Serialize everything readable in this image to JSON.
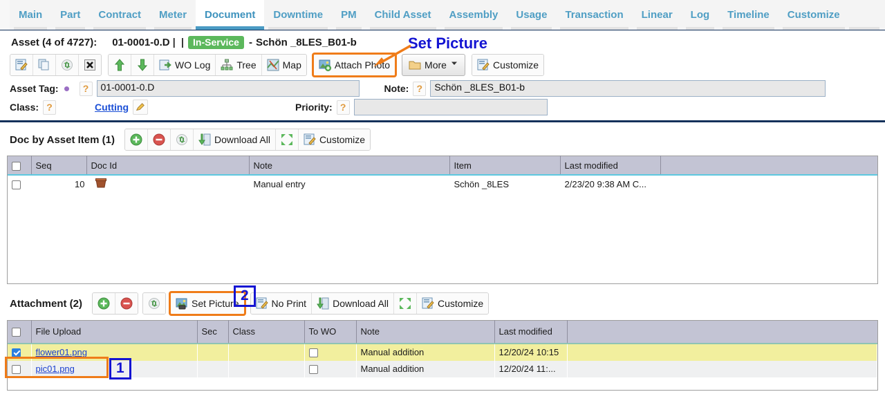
{
  "tabs": [
    {
      "label": "Main",
      "active": false
    },
    {
      "label": "Part",
      "active": false
    },
    {
      "label": "Contract",
      "active": false
    },
    {
      "label": "Meter",
      "active": false
    },
    {
      "label": "Document",
      "active": true
    },
    {
      "label": "Downtime",
      "active": false
    },
    {
      "label": "PM",
      "active": false
    },
    {
      "label": "Child Asset",
      "active": false
    },
    {
      "label": "Assembly",
      "active": false
    },
    {
      "label": "Usage",
      "active": false
    },
    {
      "label": "Transaction",
      "active": false
    },
    {
      "label": "Linear",
      "active": false
    },
    {
      "label": "Log",
      "active": false
    },
    {
      "label": "Timeline",
      "active": false
    },
    {
      "label": "Customize",
      "active": false
    }
  ],
  "asset_header": {
    "label": "Asset (4 of 4727):",
    "asset_id": "01-0001-0.D",
    "separator": "|",
    "status": "In-Service",
    "status_color": "#5cb85c",
    "dash": "-",
    "name": "Schön _8LES_B01-b"
  },
  "toolbar": {
    "edit_icon": "edit-icon",
    "copy_icon": "copy-icon",
    "refresh_icon": "refresh-icon",
    "delete_icon": "delete-icon",
    "up_icon": "arrow-up-icon",
    "down_icon": "arrow-down-icon",
    "wo_log": "WO Log",
    "tree": "Tree",
    "map": "Map",
    "attach_photo": "Attach Photo",
    "more": "More",
    "customize": "Customize"
  },
  "fields": {
    "asset_tag_label": "Asset Tag:",
    "asset_tag_value": "01-0001-0.D",
    "class_label": "Class:",
    "class_value": "Cutting",
    "note_label": "Note:",
    "note_value": "Schön _8LES_B01-b",
    "priority_label": "Priority:",
    "priority_value": "",
    "help_glyph": "?"
  },
  "doc_section": {
    "title": "Doc by Asset Item (1)",
    "add_icon": "add-icon",
    "remove_icon": "remove-icon",
    "refresh_icon": "refresh-icon",
    "download_all": "Download All",
    "expand_icon": "expand-icon",
    "customize": "Customize",
    "columns": [
      "Seq",
      "Doc Id",
      "Note",
      "Item",
      "Last modified"
    ],
    "rows": [
      {
        "checked": false,
        "seq": "10",
        "doc_id": "",
        "note": "Manual entry",
        "item": "Schön _8LES",
        "last_modified": "2/23/20 9:38 AM C..."
      }
    ]
  },
  "attachment_section": {
    "title": "Attachment (2)",
    "add_icon": "add-icon",
    "remove_icon": "remove-icon",
    "refresh_icon": "refresh-icon",
    "set_picture": "Set Picture",
    "no_print": "No Print",
    "download_all": "Download All",
    "expand_icon": "expand-icon",
    "customize": "Customize",
    "columns": [
      "File Upload",
      "Sec",
      "Class",
      "To WO",
      "Note",
      "Last modified"
    ],
    "rows": [
      {
        "checked": true,
        "highlight": true,
        "file_upload": "flower01.png",
        "sec": "",
        "class": "",
        "to_wo": false,
        "note": "Manual addition",
        "last_modified": "12/20/24 10:15"
      },
      {
        "checked": false,
        "highlight": false,
        "file_upload": "pic01.png",
        "sec": "",
        "class": "",
        "to_wo": false,
        "note": "Manual addition",
        "last_modified": "12/20/24 11:..."
      }
    ]
  },
  "annotations": {
    "callout_text": "Set Picture",
    "callout_color": "#1414d2",
    "marker_one": "1",
    "marker_two": "2",
    "arrow_color": "#ef7c19",
    "highlight_color": "#ef7c19"
  }
}
